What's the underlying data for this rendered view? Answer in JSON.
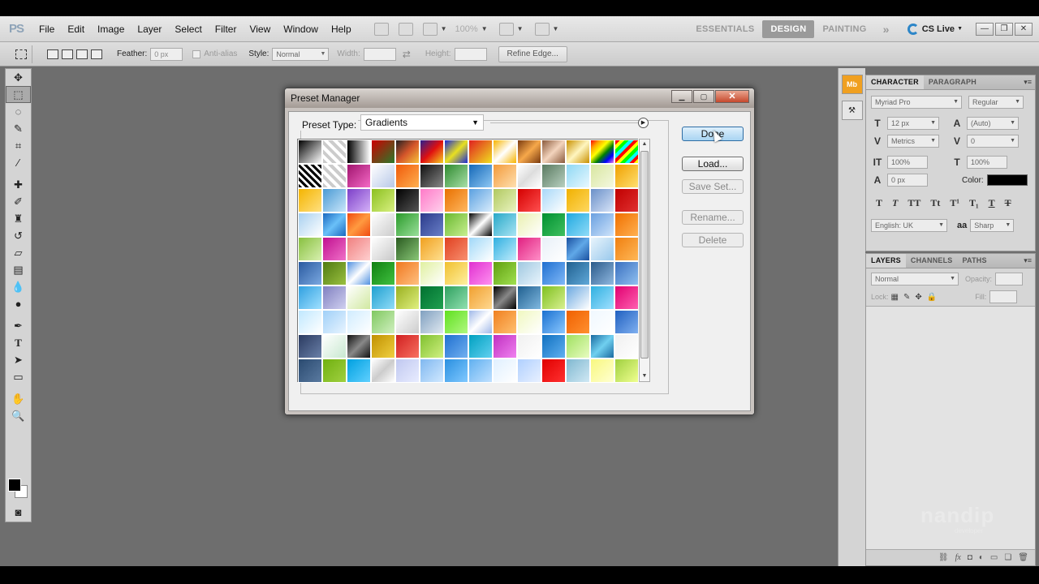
{
  "menubar": {
    "logo": "PS",
    "items": [
      "File",
      "Edit",
      "Image",
      "Layer",
      "Select",
      "Filter",
      "View",
      "Window",
      "Help"
    ],
    "zoom": "100%",
    "workspaces": [
      "ESSENTIALS",
      "DESIGN",
      "PAINTING"
    ],
    "active_workspace": "DESIGN",
    "more": "»",
    "cslive": "CS Live"
  },
  "optbar": {
    "feather_label": "Feather:",
    "feather_value": "0 px",
    "antialias_label": "Anti-alias",
    "style_label": "Style:",
    "style_value": "Normal",
    "width_label": "Width:",
    "height_label": "Height:",
    "refine_edge": "Refine Edge..."
  },
  "character_panel": {
    "tabs": [
      "CHARACTER",
      "PARAGRAPH"
    ],
    "font_family": "Myriad Pro",
    "font_style": "Regular",
    "font_size": "12 px",
    "leading": "(Auto)",
    "kerning": "Metrics",
    "tracking": "0",
    "vertical_scale": "100%",
    "horizontal_scale": "100%",
    "baseline_shift": "0 px",
    "color_label": "Color:",
    "language": "English: UK",
    "aa_label": "aa",
    "antialias": "Sharp"
  },
  "layers_panel": {
    "tabs": [
      "LAYERS",
      "CHANNELS",
      "PATHS"
    ],
    "blend_mode": "Normal",
    "opacity_label": "Opacity:",
    "lock_label": "Lock:",
    "fill_label": "Fill:"
  },
  "dialog": {
    "title": "Preset Manager",
    "preset_type_label": "Preset Type:",
    "preset_type_value": "Gradients",
    "buttons": {
      "done": "Done",
      "load": "Load...",
      "save_set": "Save Set...",
      "rename": "Rename...",
      "delete": "Delete"
    }
  },
  "gradient_swatches": [
    "linear-gradient(135deg,#000,#fff)",
    "repeating-linear-gradient(45deg,#ccc 0 4px,#fff 4px 8px)",
    "linear-gradient(90deg,#000,#fff)",
    "linear-gradient(135deg,#c00,#2a7a2a)",
    "linear-gradient(135deg,#222,#d4552a,#f7c23a)",
    "linear-gradient(135deg,#2a1f8f,#e01010,#f5d020)",
    "linear-gradient(135deg,#1b2bd6,#e8e020,#1b2bd6)",
    "linear-gradient(135deg,#e02020,#f0e020)",
    "linear-gradient(135deg,#f7b400,#fff,#f7b400)",
    "linear-gradient(135deg,#7a3a10,#f6a84a,#7a3a10)",
    "linear-gradient(135deg,#8b5a3c,#f3d4bd,#8b5a3c)",
    "linear-gradient(135deg,#c89000,#fff6c0,#c89000)",
    "linear-gradient(135deg,red,orange,yellow,green,blue,violet)",
    "repeating-linear-gradient(135deg,red 0 4px,yellow 4px 8px,lime 8px 12px,cyan 12px 16px)",
    "repeating-linear-gradient(45deg,#000 0 3px,#fff 3px 6px)",
    "repeating-linear-gradient(45deg,#ccc 0 4px,#fff 4px 8px)",
    "linear-gradient(135deg,#a0146e,#f56ac6)",
    "linear-gradient(135deg,#fff,#b8c8e8)",
    "linear-gradient(135deg,#f05a0a,#ffb050)",
    "linear-gradient(135deg,#111,#888)",
    "linear-gradient(135deg,#2f8a2f,#a8e0a8)",
    "linear-gradient(135deg,#1468b8,#8ec8f4)",
    "linear-gradient(135deg,#f39a3a,#ffe0b0)",
    "linear-gradient(135deg,#fff,#ddd,#fff)",
    "linear-gradient(135deg,#5a7a60,#b8d0c0)",
    "linear-gradient(135deg,#8fd8f4,#e8f8ff)",
    "linear-gradient(135deg,#d8e6a0,#f4f8e0)",
    "linear-gradient(135deg,#f0a000,#ffe070)",
    "linear-gradient(135deg,#f4b400,#ffe080)",
    "linear-gradient(135deg,#4a9ad4,#c8e6fa)",
    "linear-gradient(135deg,#7c3fc8,#d4b0f8)",
    "linear-gradient(135deg,#8cc020,#d8f080)",
    "linear-gradient(135deg,#000,#555)",
    "linear-gradient(135deg,#ff7ac8,#ffd0ec)",
    "linear-gradient(135deg,#e87000,#ffb860)",
    "linear-gradient(135deg,#5aa0e0,#d8ecfc)",
    "linear-gradient(135deg,#b0c860,#eaf4c0)",
    "linear-gradient(135deg,#d40000,#ff5050)",
    "linear-gradient(135deg,#a8d8f8,#fff)",
    "linear-gradient(135deg,#f0b000,#ffd860)",
    "linear-gradient(135deg,#6a90c8,#d8e4f8)",
    "linear-gradient(135deg,#c00000,#e03030)",
    "linear-gradient(135deg,#a8d0f0,#fff)",
    "linear-gradient(135deg,#1a68c0,#6ac0f8,#1a68c0)",
    "linear-gradient(135deg,#f04a10,#ff9a40,#f04a10)",
    "linear-gradient(135deg,#fff,#ccc)",
    "linear-gradient(135deg,#2a9a2a,#9ae09a)",
    "linear-gradient(135deg,#2a3a8a,#6a80c8)",
    "linear-gradient(135deg,#6ab830,#c8f090)",
    "linear-gradient(135deg,#000,#fff,#000)",
    "linear-gradient(135deg,#28a8c8,#a8e4f4)",
    "linear-gradient(135deg,#eaf0b0,#fff)",
    "linear-gradient(135deg,#009030,#40c060)",
    "linear-gradient(135deg,#20a8e0,#90dcf8)",
    "linear-gradient(135deg,#6aa0e0,#cfe4fb)",
    "linear-gradient(135deg,#f07000,#ffb050)",
    "linear-gradient(135deg,#88c040,#d8f0b0)",
    "linear-gradient(135deg,#c01090,#f070c8)",
    "linear-gradient(135deg,#f08080,#ffd0d0)",
    "linear-gradient(135deg,#fff,#c8c8c8)",
    "linear-gradient(135deg,#2a5a20,#8ac878)",
    "linear-gradient(135deg,#f0a020,#ffe090)",
    "linear-gradient(135deg,#e04020,#f89070)",
    "linear-gradient(135deg,#a0d8f8,#fff)",
    "linear-gradient(135deg,#30b0e0,#c0ecfc)",
    "linear-gradient(135deg,#e02080,#ff90c8)",
    "linear-gradient(135deg,#e8f0f8,#fff)",
    "linear-gradient(135deg,#1a50a0,#60a8e8,#1a50a0)",
    "linear-gradient(135deg,#e8f4fc,#98c8ec)",
    "linear-gradient(135deg,#f08010,#ffb858)",
    "linear-gradient(135deg,#2a5aa0,#7aa8e0)",
    "linear-gradient(135deg,#507a10,#9ac040)",
    "linear-gradient(135deg,#5090e0,#fff,#5090e0)",
    "linear-gradient(135deg,#108010,#40c040)",
    "linear-gradient(135deg,#f07820,#ffc080)",
    "linear-gradient(135deg,#e0f0a0,#fff)",
    "linear-gradient(135deg,#f0c030,#fff0a0)",
    "linear-gradient(135deg,#e030d0,#ff90f0)",
    "linear-gradient(135deg,#60a010,#a0e050)",
    "linear-gradient(135deg,#a0c8e0,#e8f4fc)",
    "linear-gradient(135deg,#2070d0,#80b8f8)",
    "linear-gradient(135deg,#206090,#60a8d8)",
    "linear-gradient(135deg,#2a5a8a,#90b8e0)",
    "linear-gradient(135deg,#3a70c0,#90c0f0)",
    "linear-gradient(135deg,#30a0e0,#a0e0ff)",
    "linear-gradient(135deg,#8080c0,#d0d0f0)",
    "linear-gradient(135deg,#fff,#d0e8a0)",
    "linear-gradient(135deg,#20a0d0,#90dcf8)",
    "linear-gradient(135deg,#9ab020,#e0f080)",
    "linear-gradient(135deg,#007030,#20a050)",
    "linear-gradient(135deg,#30a060,#90e0b0)",
    "linear-gradient(135deg,#f0a030,#ffd890)",
    "linear-gradient(135deg,#000,#888,#000)",
    "linear-gradient(135deg,#206090,#80b8e0)",
    "linear-gradient(135deg,#80c020,#d8f090)",
    "linear-gradient(135deg,#6aa8e0,#fff)",
    "linear-gradient(135deg,#30b0e0,#a0e0ff)",
    "linear-gradient(135deg,#e00070,#ff60b0)",
    "linear-gradient(135deg,#c0e8ff,#fff)",
    "linear-gradient(135deg,#a0d0f8,#e8f4ff)",
    "linear-gradient(135deg,#d0ecff,#fff)",
    "linear-gradient(135deg,#80c860,#d0f0c0)",
    "linear-gradient(135deg,#fff,#ccc)",
    "linear-gradient(135deg,#80a0c0,#e0e8f0)",
    "linear-gradient(135deg,#60e020,#b0f880)",
    "linear-gradient(135deg,#a0b8e8,#fff,#a0b8e8)",
    "linear-gradient(135deg,#f08020,#ffc070)",
    "linear-gradient(135deg,#f0f8c0,#fff)",
    "linear-gradient(135deg,#1a70d0,#8ac8ff)",
    "linear-gradient(135deg,#f06000,#ff9030)",
    "linear-gradient(135deg,#f0f8ff,#fff)",
    "linear-gradient(135deg,#2060c0,#80b0f0)",
    "linear-gradient(135deg,#2a3a60,#6a80a8)",
    "linear-gradient(135deg,#fff,#c8e8d0)",
    "linear-gradient(135deg,#111,#888,#111)",
    "linear-gradient(135deg,#c09000,#f0d040)",
    "linear-gradient(135deg,#d02020,#f87060)",
    "linear-gradient(135deg,#80c030,#d0f080)",
    "linear-gradient(135deg,#2070d0,#70b0f0)",
    "linear-gradient(135deg,#00a0c0,#60d0f0)",
    "linear-gradient(135deg,#c030c0,#f080f0)",
    "linear-gradient(135deg,#f0f0f0,#fff)",
    "linear-gradient(135deg,#1070c0,#60b0f0)",
    "linear-gradient(135deg,#a0e060,#e8fcc0)",
    "linear-gradient(135deg,#1a6aa0,#70d0f0,#1a6aa0)",
    "linear-gradient(135deg,#f0f0f0,#fff)",
    "linear-gradient(135deg,#2a4a70,#5a7aa0)",
    "linear-gradient(135deg,#70b010,#a0d040)",
    "linear-gradient(135deg,#00a0e0,#60d0ff)",
    "linear-gradient(135deg,#fff,#ccc,#fff)",
    "linear-gradient(135deg,#c0c8f0,#e8ecff)",
    "linear-gradient(135deg,#80b8f0,#d0e8ff)",
    "linear-gradient(135deg,#2a90e0,#80c8ff)",
    "linear-gradient(135deg,#60b0f0,#c0e0ff)",
    "linear-gradient(135deg,#e0f0ff,#fff)",
    "linear-gradient(135deg,#b0d0ff,#e8f0ff)",
    "linear-gradient(135deg,#e00000,#ff3030)",
    "linear-gradient(135deg,#80b8d0,#d0e8f4)",
    "linear-gradient(135deg,#f8f880,#ffffd0)",
    "linear-gradient(135deg,#a0d040,#f0ff90)"
  ]
}
